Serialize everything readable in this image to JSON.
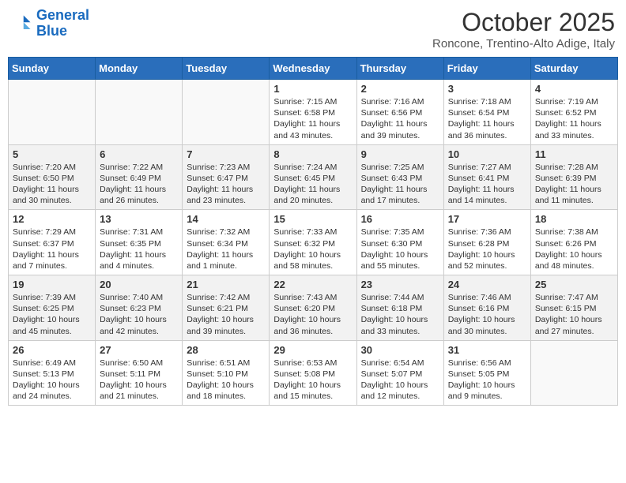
{
  "header": {
    "logo_line1": "General",
    "logo_line2": "Blue",
    "month": "October 2025",
    "location": "Roncone, Trentino-Alto Adige, Italy"
  },
  "days_of_week": [
    "Sunday",
    "Monday",
    "Tuesday",
    "Wednesday",
    "Thursday",
    "Friday",
    "Saturday"
  ],
  "weeks": [
    [
      {
        "day": "",
        "info": ""
      },
      {
        "day": "",
        "info": ""
      },
      {
        "day": "",
        "info": ""
      },
      {
        "day": "1",
        "info": "Sunrise: 7:15 AM\nSunset: 6:58 PM\nDaylight: 11 hours and 43 minutes."
      },
      {
        "day": "2",
        "info": "Sunrise: 7:16 AM\nSunset: 6:56 PM\nDaylight: 11 hours and 39 minutes."
      },
      {
        "day": "3",
        "info": "Sunrise: 7:18 AM\nSunset: 6:54 PM\nDaylight: 11 hours and 36 minutes."
      },
      {
        "day": "4",
        "info": "Sunrise: 7:19 AM\nSunset: 6:52 PM\nDaylight: 11 hours and 33 minutes."
      }
    ],
    [
      {
        "day": "5",
        "info": "Sunrise: 7:20 AM\nSunset: 6:50 PM\nDaylight: 11 hours and 30 minutes."
      },
      {
        "day": "6",
        "info": "Sunrise: 7:22 AM\nSunset: 6:49 PM\nDaylight: 11 hours and 26 minutes."
      },
      {
        "day": "7",
        "info": "Sunrise: 7:23 AM\nSunset: 6:47 PM\nDaylight: 11 hours and 23 minutes."
      },
      {
        "day": "8",
        "info": "Sunrise: 7:24 AM\nSunset: 6:45 PM\nDaylight: 11 hours and 20 minutes."
      },
      {
        "day": "9",
        "info": "Sunrise: 7:25 AM\nSunset: 6:43 PM\nDaylight: 11 hours and 17 minutes."
      },
      {
        "day": "10",
        "info": "Sunrise: 7:27 AM\nSunset: 6:41 PM\nDaylight: 11 hours and 14 minutes."
      },
      {
        "day": "11",
        "info": "Sunrise: 7:28 AM\nSunset: 6:39 PM\nDaylight: 11 hours and 11 minutes."
      }
    ],
    [
      {
        "day": "12",
        "info": "Sunrise: 7:29 AM\nSunset: 6:37 PM\nDaylight: 11 hours and 7 minutes."
      },
      {
        "day": "13",
        "info": "Sunrise: 7:31 AM\nSunset: 6:35 PM\nDaylight: 11 hours and 4 minutes."
      },
      {
        "day": "14",
        "info": "Sunrise: 7:32 AM\nSunset: 6:34 PM\nDaylight: 11 hours and 1 minute."
      },
      {
        "day": "15",
        "info": "Sunrise: 7:33 AM\nSunset: 6:32 PM\nDaylight: 10 hours and 58 minutes."
      },
      {
        "day": "16",
        "info": "Sunrise: 7:35 AM\nSunset: 6:30 PM\nDaylight: 10 hours and 55 minutes."
      },
      {
        "day": "17",
        "info": "Sunrise: 7:36 AM\nSunset: 6:28 PM\nDaylight: 10 hours and 52 minutes."
      },
      {
        "day": "18",
        "info": "Sunrise: 7:38 AM\nSunset: 6:26 PM\nDaylight: 10 hours and 48 minutes."
      }
    ],
    [
      {
        "day": "19",
        "info": "Sunrise: 7:39 AM\nSunset: 6:25 PM\nDaylight: 10 hours and 45 minutes."
      },
      {
        "day": "20",
        "info": "Sunrise: 7:40 AM\nSunset: 6:23 PM\nDaylight: 10 hours and 42 minutes."
      },
      {
        "day": "21",
        "info": "Sunrise: 7:42 AM\nSunset: 6:21 PM\nDaylight: 10 hours and 39 minutes."
      },
      {
        "day": "22",
        "info": "Sunrise: 7:43 AM\nSunset: 6:20 PM\nDaylight: 10 hours and 36 minutes."
      },
      {
        "day": "23",
        "info": "Sunrise: 7:44 AM\nSunset: 6:18 PM\nDaylight: 10 hours and 33 minutes."
      },
      {
        "day": "24",
        "info": "Sunrise: 7:46 AM\nSunset: 6:16 PM\nDaylight: 10 hours and 30 minutes."
      },
      {
        "day": "25",
        "info": "Sunrise: 7:47 AM\nSunset: 6:15 PM\nDaylight: 10 hours and 27 minutes."
      }
    ],
    [
      {
        "day": "26",
        "info": "Sunrise: 6:49 AM\nSunset: 5:13 PM\nDaylight: 10 hours and 24 minutes."
      },
      {
        "day": "27",
        "info": "Sunrise: 6:50 AM\nSunset: 5:11 PM\nDaylight: 10 hours and 21 minutes."
      },
      {
        "day": "28",
        "info": "Sunrise: 6:51 AM\nSunset: 5:10 PM\nDaylight: 10 hours and 18 minutes."
      },
      {
        "day": "29",
        "info": "Sunrise: 6:53 AM\nSunset: 5:08 PM\nDaylight: 10 hours and 15 minutes."
      },
      {
        "day": "30",
        "info": "Sunrise: 6:54 AM\nSunset: 5:07 PM\nDaylight: 10 hours and 12 minutes."
      },
      {
        "day": "31",
        "info": "Sunrise: 6:56 AM\nSunset: 5:05 PM\nDaylight: 10 hours and 9 minutes."
      },
      {
        "day": "",
        "info": ""
      }
    ]
  ]
}
